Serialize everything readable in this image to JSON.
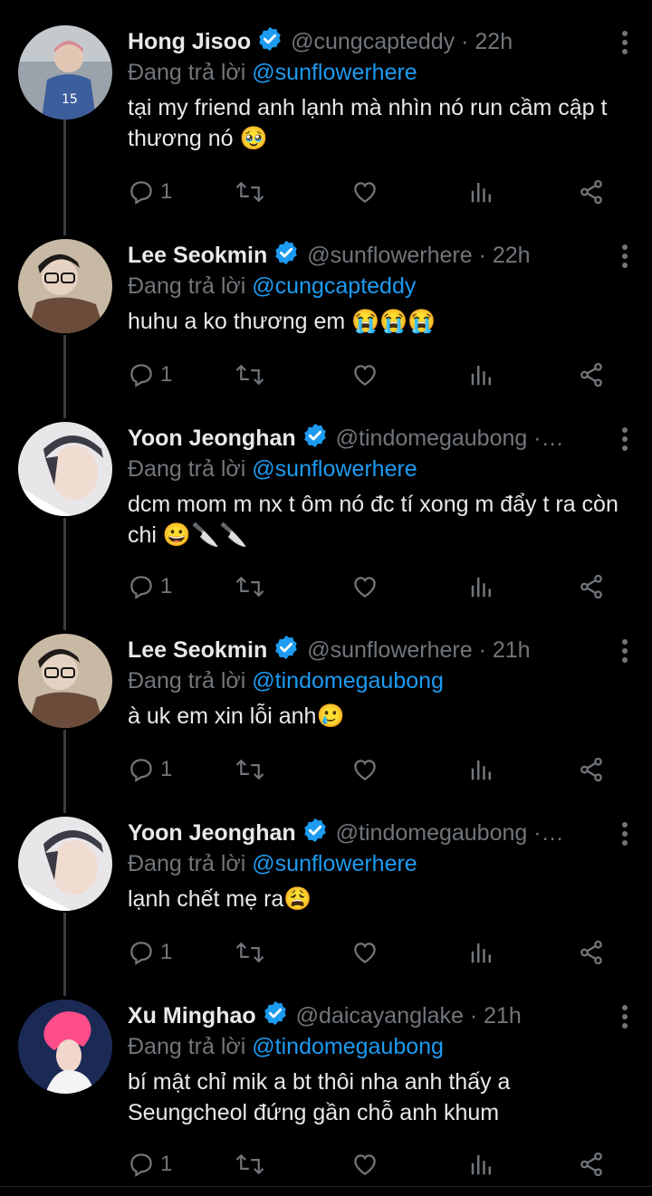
{
  "reply_prefix": "Đang trả lời",
  "tweets": [
    {
      "name": "Hong Jisoo",
      "handle": "@cungcapteddy",
      "time": "22h",
      "meta": "@cungcapteddy · 22h",
      "reply_to": "@sunflowerhere",
      "text": "tại my friend anh lạnh mà nhìn nó run cầm cập t thương nó 🥹",
      "replies": "1",
      "avatar_colors": [
        "#9aa3ab",
        "#3d5e9c"
      ]
    },
    {
      "name": "Lee Seokmin",
      "handle": "@sunflowerhere",
      "time": "22h",
      "meta": "@sunflowerhere · 22h",
      "reply_to": "@cungcapteddy",
      "text": "huhu a ko thương em 😭😭😭",
      "replies": "1",
      "avatar_colors": [
        "#c8b9a5",
        "#6b4c3b"
      ]
    },
    {
      "name": "Yoon Jeonghan",
      "handle": "@tindomegaubong",
      "time": "",
      "meta": "@tindomegaubong ·…",
      "reply_to": "@sunflowerhere",
      "text": "dcm mom m nx t ôm nó đc tí xong m đẩy t ra còn chi 😀🔪🔪",
      "replies": "1",
      "avatar_colors": [
        "#e9e6ea",
        "#3b3b45"
      ]
    },
    {
      "name": "Lee Seokmin",
      "handle": "@sunflowerhere",
      "time": "21h",
      "meta": "@sunflowerhere · 21h",
      "reply_to": "@tindomegaubong",
      "text": "à uk em xin lỗi anh🥲",
      "replies": "1",
      "avatar_colors": [
        "#c8b9a5",
        "#6b4c3b"
      ]
    },
    {
      "name": "Yoon Jeonghan",
      "handle": "@tindomegaubong",
      "time": "",
      "meta": "@tindomegaubong ·…",
      "reply_to": "@sunflowerhere",
      "text": "lạnh chết mẹ ra😩",
      "replies": "1",
      "avatar_colors": [
        "#e9e6ea",
        "#3b3b45"
      ]
    },
    {
      "name": "Xu Minghao",
      "handle": "@daicayanglake",
      "time": "21h",
      "meta": "@daicayanglake · 21h",
      "reply_to": "@tindomegaubong",
      "text": "bí mật chỉ mik a bt thôi nha anh thấy a Seungcheol đứng gần chỗ anh khum",
      "replies": "1",
      "avatar_colors": [
        "#1b2a55",
        "#ff4d8a"
      ]
    }
  ],
  "icons": {
    "verified": "verified-badge-icon",
    "more": "more-vertical-icon",
    "reply": "reply-icon",
    "retweet": "retweet-icon",
    "like": "heart-icon",
    "views": "views-icon",
    "share": "share-icon"
  },
  "colors": {
    "background": "#000000",
    "text": "#e7e9ea",
    "muted": "#71767b",
    "link": "#1d9bf0",
    "thread": "#3a3d40"
  }
}
